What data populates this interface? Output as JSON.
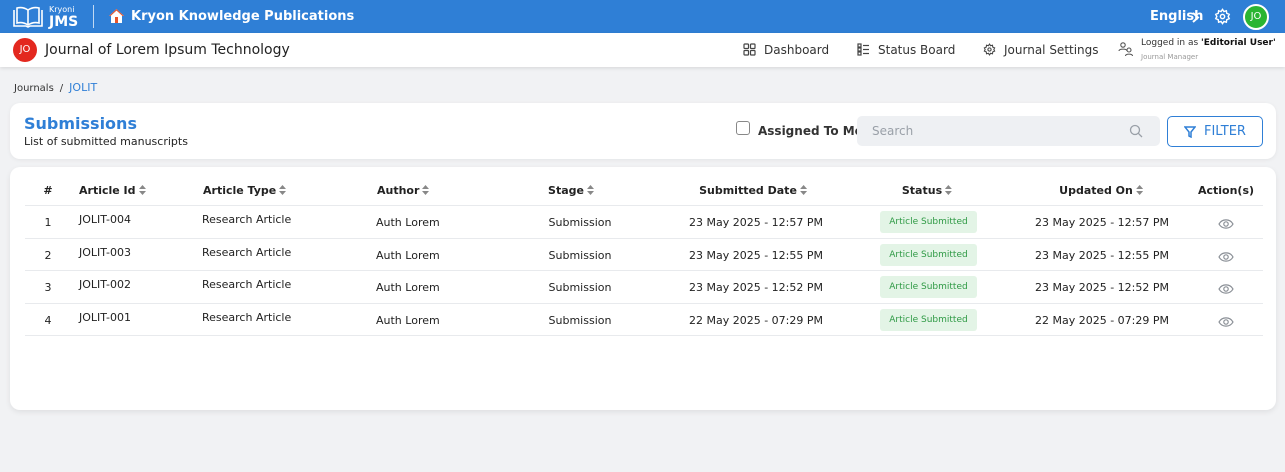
{
  "topbar": {
    "logo_small": "Kryoni",
    "logo_big": "JMS",
    "publisher": "Kryon Knowledge Publications",
    "language": "English",
    "user_initials": "JO"
  },
  "subbar": {
    "journal_initials": "JO",
    "journal_title": "Journal of Lorem Ipsum Technology",
    "nav": [
      {
        "label": "Dashboard",
        "icon": "grid-icon"
      },
      {
        "label": "Status Board",
        "icon": "list-icon"
      },
      {
        "label": "Journal Settings",
        "icon": "settings-icon"
      }
    ],
    "login_prefix": "Logged in as ",
    "login_user": "'Editorial User'",
    "login_role": "Journal Manager"
  },
  "breadcrumb": {
    "journals": "Journals",
    "separator": "/",
    "current": "JOLIT"
  },
  "submissions": {
    "title": "Submissions",
    "description": "List of submitted manuscripts",
    "assigned_label": "Assigned To Me",
    "assigned_checked": false,
    "search_placeholder": "Search",
    "filter_label": "FILTER"
  },
  "table": {
    "columns": [
      "#",
      "Article Id",
      "Article Type",
      "Author",
      "Stage",
      "Submitted Date",
      "Status",
      "Updated On",
      "Action(s)"
    ],
    "rows": [
      {
        "num": "1",
        "id": "JOLIT-004",
        "type": "Research Article",
        "author": "Auth Lorem",
        "stage": "Submission",
        "submitted": "23 May 2025 - 12:57 PM",
        "status": "Article Submitted",
        "updated": "23 May 2025 - 12:57 PM"
      },
      {
        "num": "2",
        "id": "JOLIT-003",
        "type": "Research Article",
        "author": "Auth Lorem",
        "stage": "Submission",
        "submitted": "23 May 2025 - 12:55 PM",
        "status": "Article Submitted",
        "updated": "23 May 2025 - 12:55 PM"
      },
      {
        "num": "3",
        "id": "JOLIT-002",
        "type": "Research Article",
        "author": "Auth Lorem",
        "stage": "Submission",
        "submitted": "23 May 2025 - 12:52 PM",
        "status": "Article Submitted",
        "updated": "23 May 2025 - 12:52 PM"
      },
      {
        "num": "4",
        "id": "JOLIT-001",
        "type": "Research Article",
        "author": "Auth Lorem",
        "stage": "Submission",
        "submitted": "22 May 2025 - 07:29 PM",
        "status": "Article Submitted",
        "updated": "22 May 2025 - 07:29 PM"
      }
    ]
  },
  "colors": {
    "primary": "#2f7fd6",
    "journal_avatar": "#e3281f",
    "user_avatar": "#2ab532",
    "status_bg": "#e3f4e6",
    "status_text": "#2f9a45"
  }
}
